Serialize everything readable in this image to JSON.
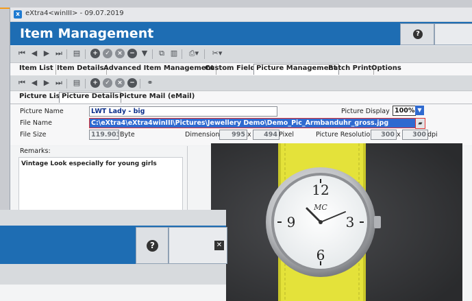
{
  "window": {
    "title": "eXtra4<winIII> - 09.07.2019",
    "app_icon": "x-app-icon"
  },
  "header": {
    "title": "Item Management",
    "help_icon": "question-circle-icon"
  },
  "toolbar1": {
    "buttons": [
      "first-icon",
      "prev-icon",
      "next-icon",
      "last-icon",
      "list-icon",
      "add-icon",
      "confirm-icon",
      "cancel-icon",
      "remove-icon",
      "filter-icon",
      "copy-icon",
      "paste-icon",
      "print-icon",
      "tools-icon"
    ]
  },
  "tabs1": [
    {
      "label": "Item List"
    },
    {
      "label": "Item Details"
    },
    {
      "label": "Advanced Item Management"
    },
    {
      "label": "Custom Fields"
    },
    {
      "label": "Picture Management"
    },
    {
      "label": "Batch Print"
    },
    {
      "label": "Options"
    }
  ],
  "toolbar2": {
    "buttons": [
      "first-icon",
      "prev-icon",
      "next-icon",
      "last-icon",
      "list-icon",
      "add-icon",
      "confirm-icon",
      "cancel-icon",
      "remove-icon",
      "link-icon"
    ]
  },
  "tabs2": [
    {
      "label": "Picture List"
    },
    {
      "label": "Picture Details"
    },
    {
      "label": "Picture Mail (eMail)"
    }
  ],
  "form": {
    "picture_name_label": "Picture Name",
    "picture_name_value": "LWT Lady - big",
    "picture_display_label": "Picture Display",
    "picture_display_value": "100%",
    "file_name_label": "File Name",
    "file_name_value": "C:\\eXtra4\\eXtra4winIII\\Pictures\\Jewellery Demo\\Demo_Pic_Armbanduhr_gross.jpg",
    "file_size_label": "File Size",
    "file_size_value": "119.903",
    "file_size_unit": "Byte",
    "dimension_label": "Dimension",
    "dimension_w": "995",
    "dimension_x": "x",
    "dimension_h": "494",
    "dimension_unit": "Pixel",
    "resolution_label": "Picture Resolution",
    "resolution_w": "300",
    "resolution_x": "x",
    "resolution_h": "300",
    "resolution_unit": "dpi"
  },
  "remarks": {
    "label": "Remarks:",
    "text": "Vintage Look especially for young girls"
  },
  "photo": {
    "brand": "MC",
    "numerals": [
      "12",
      "3",
      "6",
      "9"
    ],
    "strap_color": "#e4e23a"
  },
  "front_window": {
    "help_icon": "question-circle-icon",
    "close_icon": "close-icon"
  },
  "colors": {
    "header_blue": "#1e6db3",
    "accent_orange": "#f39a1b",
    "selection_blue": "#2f6ad0"
  }
}
